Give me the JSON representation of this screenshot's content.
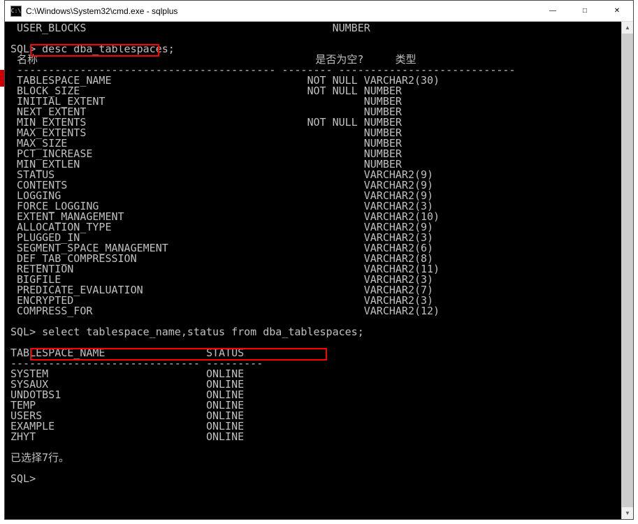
{
  "window": {
    "title": "C:\\Windows\\System32\\cmd.exe - sqlplus",
    "icon_label": "C:\\"
  },
  "truncated_line": " USER_BLOCKS                                       NUMBER",
  "prompt1": "SQL>",
  "command1": "desc dba_tablespaces;",
  "desc_header": {
    "name_label": " 名称",
    "null_label": "是否为空?",
    "type_label": "类型"
  },
  "desc_rule": " ----------------------------------------- -------- ----------------------------",
  "desc_rows": [
    {
      "name": " TABLESPACE_NAME",
      "nul": "NOT NULL",
      "type": "VARCHAR2(30)"
    },
    {
      "name": " BLOCK_SIZE",
      "nul": "NOT NULL",
      "type": "NUMBER"
    },
    {
      "name": " INITIAL_EXTENT",
      "nul": "",
      "type": "NUMBER"
    },
    {
      "name": " NEXT_EXTENT",
      "nul": "",
      "type": "NUMBER"
    },
    {
      "name": " MIN_EXTENTS",
      "nul": "NOT NULL",
      "type": "NUMBER"
    },
    {
      "name": " MAX_EXTENTS",
      "nul": "",
      "type": "NUMBER"
    },
    {
      "name": " MAX_SIZE",
      "nul": "",
      "type": "NUMBER"
    },
    {
      "name": " PCT_INCREASE",
      "nul": "",
      "type": "NUMBER"
    },
    {
      "name": " MIN_EXTLEN",
      "nul": "",
      "type": "NUMBER"
    },
    {
      "name": " STATUS",
      "nul": "",
      "type": "VARCHAR2(9)"
    },
    {
      "name": " CONTENTS",
      "nul": "",
      "type": "VARCHAR2(9)"
    },
    {
      "name": " LOGGING",
      "nul": "",
      "type": "VARCHAR2(9)"
    },
    {
      "name": " FORCE_LOGGING",
      "nul": "",
      "type": "VARCHAR2(3)"
    },
    {
      "name": " EXTENT_MANAGEMENT",
      "nul": "",
      "type": "VARCHAR2(10)"
    },
    {
      "name": " ALLOCATION_TYPE",
      "nul": "",
      "type": "VARCHAR2(9)"
    },
    {
      "name": " PLUGGED_IN",
      "nul": "",
      "type": "VARCHAR2(3)"
    },
    {
      "name": " SEGMENT_SPACE_MANAGEMENT",
      "nul": "",
      "type": "VARCHAR2(6)"
    },
    {
      "name": " DEF_TAB_COMPRESSION",
      "nul": "",
      "type": "VARCHAR2(8)"
    },
    {
      "name": " RETENTION",
      "nul": "",
      "type": "VARCHAR2(11)"
    },
    {
      "name": " BIGFILE",
      "nul": "",
      "type": "VARCHAR2(3)"
    },
    {
      "name": " PREDICATE_EVALUATION",
      "nul": "",
      "type": "VARCHAR2(7)"
    },
    {
      "name": " ENCRYPTED",
      "nul": "",
      "type": "VARCHAR2(3)"
    },
    {
      "name": " COMPRESS_FOR",
      "nul": "",
      "type": "VARCHAR2(12)"
    }
  ],
  "prompt2": "SQL>",
  "command2": "select tablespace_name,status from dba_tablespaces;",
  "query_header": {
    "col1": "TABLESPACE_NAME",
    "col2": "STATUS"
  },
  "query_rule": "------------------------------ ---------",
  "query_rows": [
    {
      "c1": "SYSTEM",
      "c2": "ONLINE"
    },
    {
      "c1": "SYSAUX",
      "c2": "ONLINE"
    },
    {
      "c1": "UNDOTBS1",
      "c2": "ONLINE"
    },
    {
      "c1": "TEMP",
      "c2": "ONLINE"
    },
    {
      "c1": "USERS",
      "c2": "ONLINE"
    },
    {
      "c1": "EXAMPLE",
      "c2": "ONLINE"
    },
    {
      "c1": "ZHYT",
      "c2": "ONLINE"
    }
  ],
  "rows_selected": "已选择7行。",
  "prompt3": "SQL>"
}
